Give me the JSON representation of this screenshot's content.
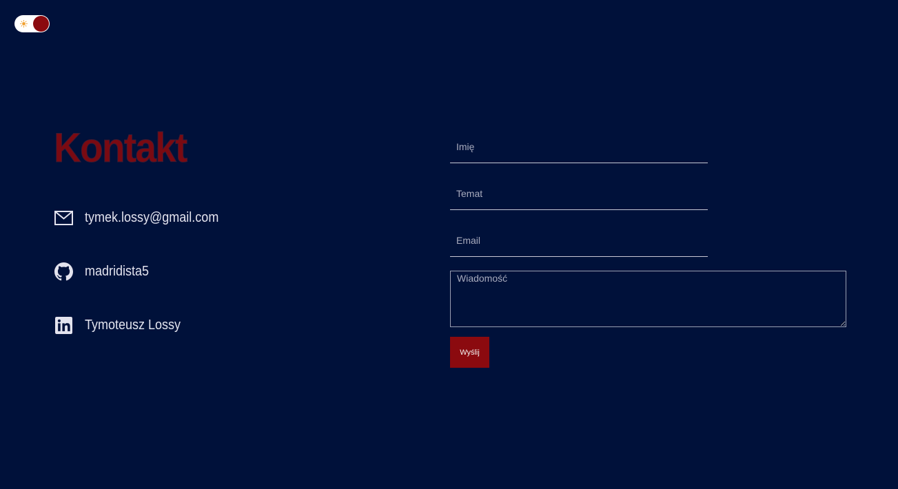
{
  "theme_toggle": {
    "icon": "sun-icon",
    "colors": {
      "track": "#ffffff",
      "knob": "#8b0a0f",
      "sun": "#f0a030"
    }
  },
  "contact": {
    "title": "Kontakt",
    "items": [
      {
        "icon": "mail-icon",
        "text": "tymek.lossy@gmail.com"
      },
      {
        "icon": "github-icon",
        "text": "madridista5"
      },
      {
        "icon": "linkedin-icon",
        "text": "Tymoteusz Lossy"
      }
    ]
  },
  "form": {
    "name_placeholder": "Imię",
    "subject_placeholder": "Temat",
    "email_placeholder": "Email",
    "message_placeholder": "Wiadomość",
    "submit_label": "Wyślij"
  },
  "colors": {
    "background": "#00113a",
    "accent": "#8b0a0f",
    "text": "#e3e3ee"
  }
}
